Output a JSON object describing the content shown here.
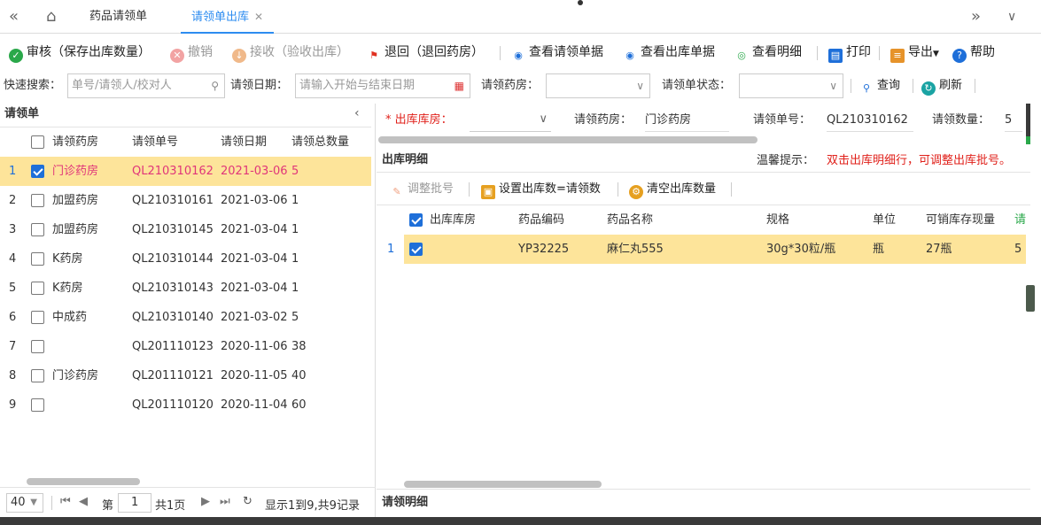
{
  "tabs": {
    "list_tab": "药品请领单",
    "active_tab": "请领单出库"
  },
  "toolbar": {
    "audit": "审核（保存出库数量）",
    "revoke": "撤销",
    "receive": "接收（验收出库）",
    "return": "退回（退回药房）",
    "view_request": "查看请领单据",
    "view_outbound": "查看出库单据",
    "view_detail": "查看明细",
    "print": "打印",
    "export": "导出",
    "help": "帮助"
  },
  "search": {
    "quick_label": "快速搜索：",
    "quick_placeholder": "单号/请领人/校对人",
    "date_label": "请领日期：",
    "date_placeholder": "请输入开始与结束日期",
    "pharmacy_label": "请领药房：",
    "status_label": "请领单状态：",
    "query": "查询",
    "refresh": "刷新"
  },
  "left": {
    "title": "请领单",
    "columns": [
      "请领药房",
      "请领单号",
      "请领日期",
      "请领总数量"
    ],
    "rows": [
      {
        "n": "1",
        "pharmacy": "门诊药房",
        "no": "QL210310162",
        "date": "2021-03-06",
        "qty": "5",
        "checked": true
      },
      {
        "n": "2",
        "pharmacy": "加盟药房",
        "no": "QL210310161",
        "date": "2021-03-06",
        "qty": "1",
        "checked": false
      },
      {
        "n": "3",
        "pharmacy": "加盟药房",
        "no": "QL210310145",
        "date": "2021-03-04",
        "qty": "1",
        "checked": false
      },
      {
        "n": "4",
        "pharmacy": "K药房",
        "no": "QL210310144",
        "date": "2021-03-04",
        "qty": "1",
        "checked": false
      },
      {
        "n": "5",
        "pharmacy": "K药房",
        "no": "QL210310143",
        "date": "2021-03-04",
        "qty": "1",
        "checked": false
      },
      {
        "n": "6",
        "pharmacy": "中成药",
        "no": "QL210310140",
        "date": "2021-03-02",
        "qty": "5",
        "checked": false
      },
      {
        "n": "7",
        "pharmacy": "",
        "no": "QL201110123",
        "date": "2020-11-06",
        "qty": "38",
        "checked": false
      },
      {
        "n": "8",
        "pharmacy": "门诊药房",
        "no": "QL201110121",
        "date": "2020-11-05",
        "qty": "40",
        "checked": false
      },
      {
        "n": "9",
        "pharmacy": "",
        "no": "QL201110120",
        "date": "2020-11-04",
        "qty": "60",
        "checked": false
      }
    ],
    "pager": {
      "page_size": "40",
      "page_label": "第",
      "page": "1",
      "total_pages": "共1页",
      "summary": "显示1到9,共9记录"
    }
  },
  "right": {
    "out_store_label": "出库库房：",
    "pharmacy_label": "请领药房：",
    "pharmacy_value": "门诊药房",
    "no_label": "请领单号：",
    "no_value": "QL210310162",
    "qty_label": "请领数量：",
    "qty_value": "5",
    "detail_title": "出库明细",
    "tip_label": "温馨提示：",
    "tip_text": "双击出库明细行，可调整出库批号。",
    "btn_adjust": "调整批号",
    "btn_set_qty": "设置出库数=请领数",
    "btn_clear": "清空出库数量",
    "columns": [
      "出库库房",
      "药品编码",
      "药品名称",
      "规格",
      "单位",
      "可销库存现量",
      "请领"
    ],
    "row": {
      "n": "1",
      "store": "",
      "code": "YP32225",
      "name": "麻仁丸555",
      "spec": "30g*30粒/瓶",
      "unit": "瓶",
      "stock": "27瓶",
      "qty": "5"
    },
    "request_detail_title": "请领明细"
  }
}
